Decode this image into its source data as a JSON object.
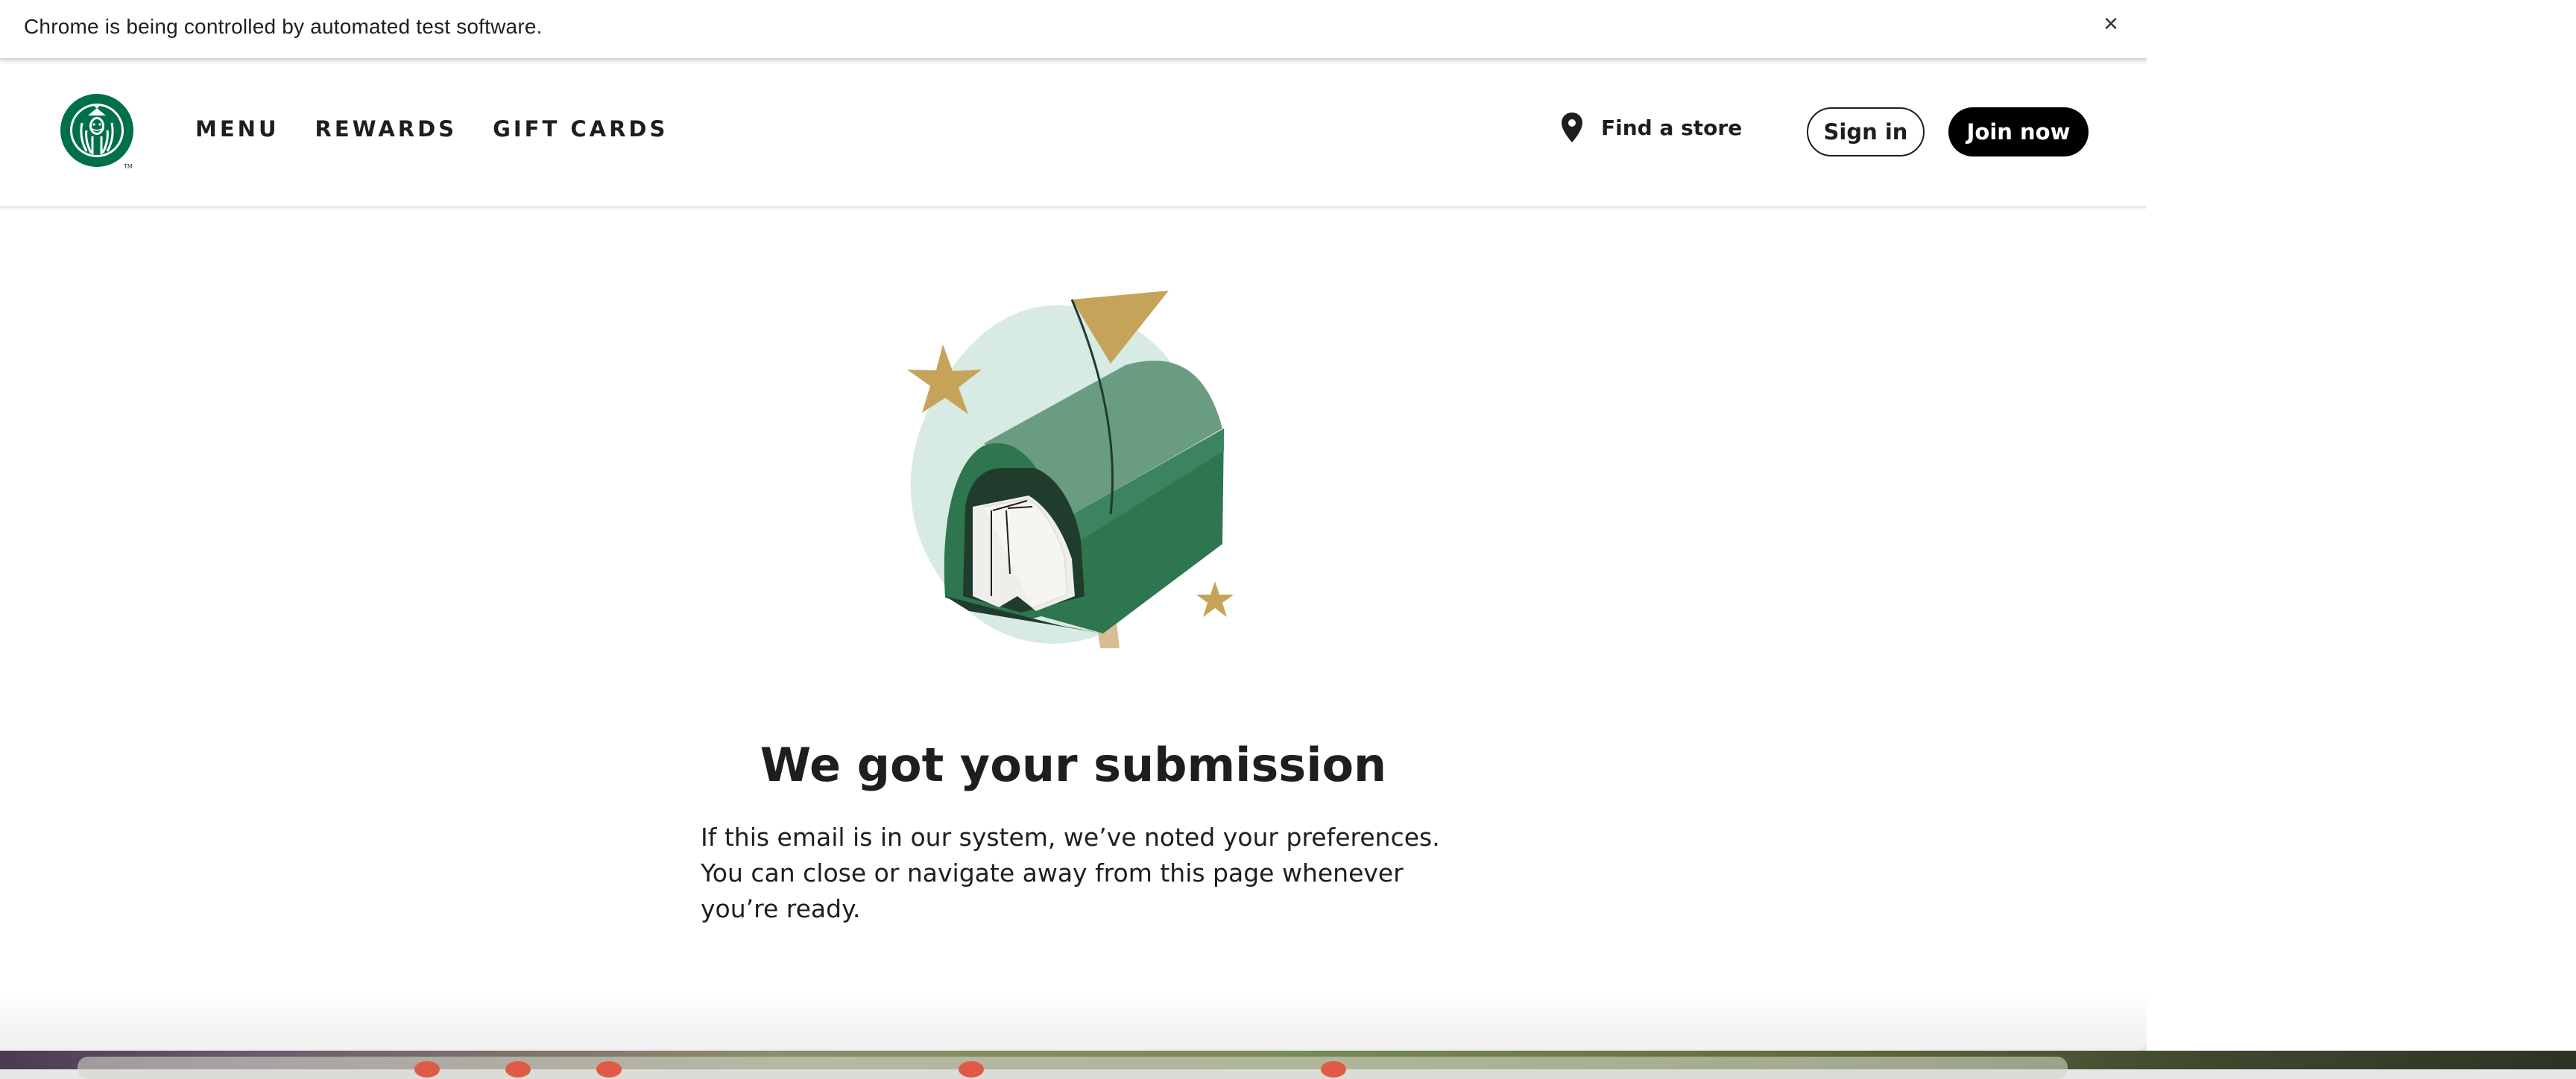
{
  "automation_bar": {
    "message": "Chrome is being controlled by automated test software.",
    "close_label": "×"
  },
  "header": {
    "logo_icon": "starbucks-siren-logo",
    "nav": [
      {
        "label": "MENU"
      },
      {
        "label": "REWARDS"
      },
      {
        "label": "GIFT CARDS"
      }
    ],
    "find_store": {
      "icon": "location-pin-icon",
      "label": "Find a store"
    },
    "sign_in_label": "Sign in",
    "join_now_label": "Join now"
  },
  "main": {
    "illustration": "mailbox-illustration",
    "headline": "We got your submission",
    "body": "If this email is in our system, we’ve noted your preferences. You can close or navigate away from this page whenever you’re ready."
  },
  "colors": {
    "brand_green": "#00704A",
    "mailbox_green": "#2E7650",
    "mailbox_light": "#6A9C82",
    "gold": "#C5A45A",
    "circle_mint": "#D7EAE3",
    "text": "#1E1E1E"
  }
}
